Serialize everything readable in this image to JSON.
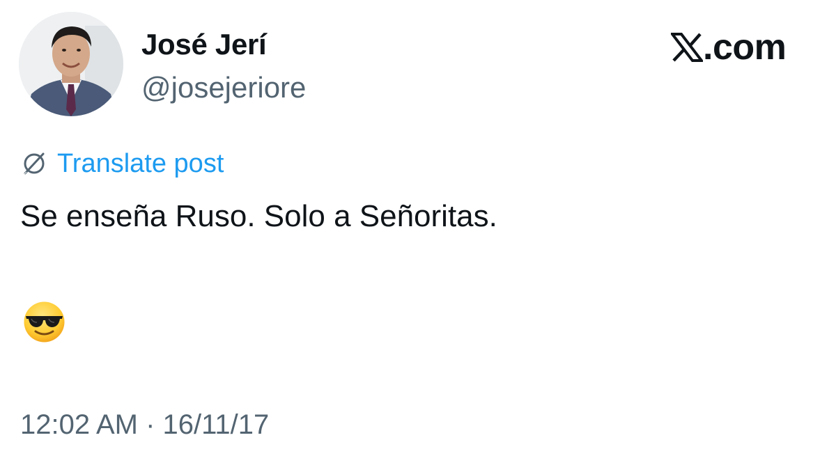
{
  "author": {
    "display_name": "José Jerí",
    "handle": "@josejeriore",
    "avatar_icon": "profile-photo"
  },
  "platform": {
    "logo_icon": "x-logo-icon",
    "domain": ".com"
  },
  "translate": {
    "icon": "globe-slash-icon",
    "label": "Translate post"
  },
  "post": {
    "text": "Se enseña Ruso. Solo a Señoritas.",
    "emoji": "😎",
    "emoji_name": "smiling-face-with-sunglasses"
  },
  "meta": {
    "timestamp": "12:02 AM · 16/11/17"
  },
  "colors": {
    "text_primary": "#0f1419",
    "text_secondary": "#536471",
    "link": "#1d9bf0",
    "background": "#ffffff"
  }
}
